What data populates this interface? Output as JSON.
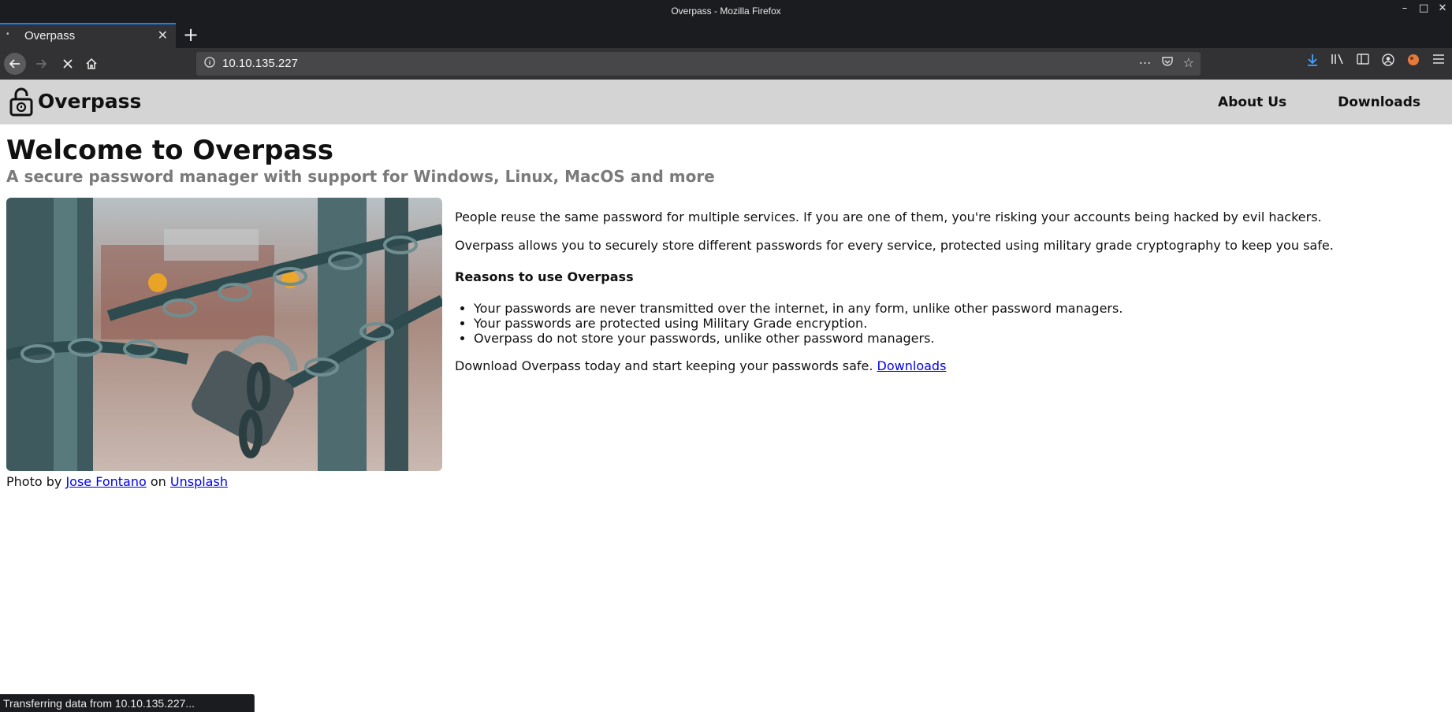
{
  "window": {
    "title": "Overpass - Mozilla Firefox",
    "controls": [
      "–",
      "□",
      "✕"
    ]
  },
  "tab": {
    "label": "Overpass",
    "close": "✕",
    "new_tab": "+"
  },
  "navbar": {
    "url": "10.10.135.227"
  },
  "status_bar": {
    "text": "Transferring data from 10.10.135.227..."
  },
  "site": {
    "name": "Overpass",
    "nav": [
      "About Us",
      "Downloads"
    ]
  },
  "page": {
    "title": "Welcome to Overpass",
    "subtitle": "A secure password manager with support for Windows, Linux, MacOS and more",
    "photo_credit": {
      "prefix": "Photo by ",
      "author": "Jose Fontano",
      "middle": " on ",
      "source": "Unsplash"
    },
    "paragraph1": "People reuse the same password for multiple services. If you are one of them, you're risking your accounts being hacked by evil hackers.",
    "paragraph2": "Overpass allows you to securely store different passwords for every service, protected using military grade cryptography to keep you safe.",
    "reasons_heading": "Reasons to use Overpass",
    "reasons": [
      "Your passwords are never transmitted over the internet, in any form, unlike other password managers.",
      "Your passwords are protected using Military Grade encryption.",
      "Overpass do not store your passwords, unlike other password managers."
    ],
    "download_text": "Download Overpass today and start keeping your passwords safe. ",
    "download_link": "Downloads"
  },
  "colors": {
    "chrome_dark": "#1b1c1f",
    "chrome_toolbar": "#323234",
    "accent_blue": "#0a84ff",
    "site_header": "#d4d4d4",
    "link": "#0000ee",
    "subtitle": "#7a7a7a"
  }
}
